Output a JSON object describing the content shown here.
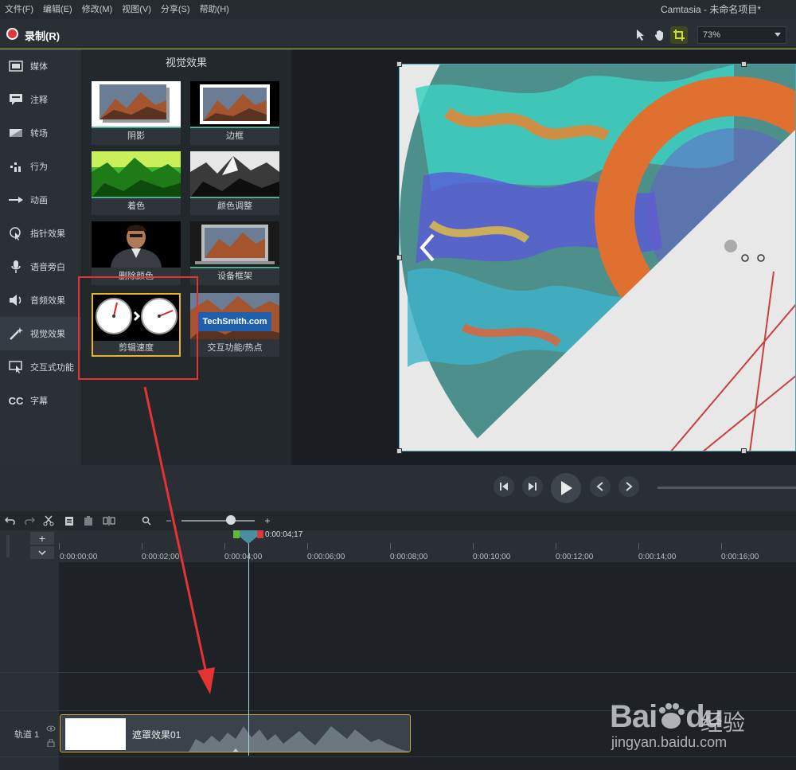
{
  "menu": {
    "items": [
      "文件(F)",
      "编辑(E)",
      "修改(M)",
      "视图(V)",
      "分享(S)",
      "帮助(H)"
    ],
    "app_title": "Camtasia - 未命名项目*"
  },
  "toolbar": {
    "record_label": "录制(R)",
    "zoom_value": "73%"
  },
  "sidebar": {
    "items": [
      {
        "label": "媒体",
        "icon": "media-icon"
      },
      {
        "label": "注释",
        "icon": "annotation-icon"
      },
      {
        "label": "转场",
        "icon": "transition-icon"
      },
      {
        "label": "行为",
        "icon": "behavior-icon"
      },
      {
        "label": "动画",
        "icon": "animation-icon"
      },
      {
        "label": "指针效果",
        "icon": "cursor-effect-icon"
      },
      {
        "label": "语音旁白",
        "icon": "microphone-icon"
      },
      {
        "label": "音频效果",
        "icon": "speaker-icon"
      },
      {
        "label": "视觉效果",
        "icon": "magic-wand-icon"
      },
      {
        "label": "交互式功能",
        "icon": "interactive-icon"
      },
      {
        "label": "字幕",
        "icon": "cc-icon"
      }
    ]
  },
  "effects": {
    "title": "视觉效果",
    "tiles": [
      {
        "label": "阴影"
      },
      {
        "label": "边框"
      },
      {
        "label": "着色"
      },
      {
        "label": "颜色调整"
      },
      {
        "label": "删除颜色"
      },
      {
        "label": "设备框架"
      },
      {
        "label": "剪辑速度"
      },
      {
        "label": "交互功能/热点"
      }
    ],
    "hotspot_text": "TechSmith.com"
  },
  "timeline": {
    "playhead_time": "0:00:04;17",
    "ruler_labels": [
      "0:00:00;00",
      "0:00:02;00",
      "0:00:04;00",
      "0:00:06;00",
      "0:00:08;00",
      "0:00:10;00",
      "0:00:12;00",
      "0:00:14;00",
      "0:00:16;00"
    ],
    "track_label": "轨道 1",
    "clip_label": "遮罩效果01"
  },
  "watermark": {
    "logo": "Bai",
    "logo_suffix": "du",
    "cn": "经验",
    "url": "jingyan.baidu.com"
  },
  "colors": {
    "accent": "#b7c94a",
    "record": "#e0353a",
    "selection": "#e8b52a",
    "annotation": "#e53232"
  }
}
